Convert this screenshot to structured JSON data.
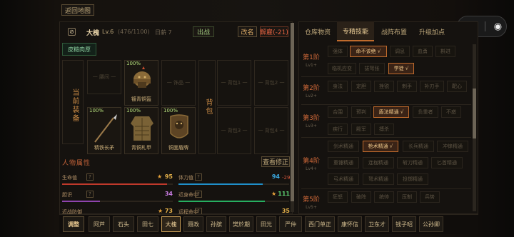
{
  "top": {
    "back_button": "返回地图"
  },
  "mini": {
    "dots_icon": "•••",
    "close_icon": "◉"
  },
  "hero": {
    "name": "大槐",
    "level": "Lv.6",
    "exp": "(476/1100)",
    "salary": "日薪 7",
    "expedition_button": "出战",
    "rename_button": "改名",
    "dismiss_button": "解雇(-21)",
    "tag": "皮糙肉厚"
  },
  "equip": {
    "left_label": "当前装备",
    "right_label": "背包",
    "slot_empty_1": "一 腰间 一",
    "slot_empty_2": "一 饰品 一",
    "helmet_pct": "100%",
    "helmet_name": "镀青铜盔",
    "weapon_pct": "100%",
    "weapon_name": "精铁长矛",
    "armor_pct": "100%",
    "armor_name": "青铜札甲",
    "shield_pct": "100%",
    "shield_name": "铜面盾牌",
    "bag1": "一 背包1 一",
    "bag2": "一 背包2 一",
    "bag3": "一 背包3 一",
    "bag4": "一 背包4 一"
  },
  "attrs": {
    "title": "人物属性",
    "detail_button": "查看修正",
    "hp_label": "生命值",
    "hp_value": "95",
    "hp_fill": 0.95,
    "stamina_label": "体力值",
    "stamina_value": "94",
    "stamina_delta": "-29",
    "stamina_fill": 0.76,
    "courage_label": "胆识",
    "courage_value": "34",
    "courage_fill": 0.34,
    "melee_label": "近身命中",
    "melee_value": "111",
    "melee_fill": 0.78,
    "ranged_label": "远程命中",
    "ranged_value": "35",
    "dodge_label": "近战防御",
    "dodge_value": "73",
    "help_mark": "?",
    "star": "★"
  },
  "tabs": {
    "t1": "仓库物资",
    "t2": "专精技能",
    "t3": "战阵布置",
    "t4": "升级加点"
  },
  "tiers": {
    "r1": "第1阶",
    "r1s": "Lv1+",
    "r2": "第2阶",
    "r2s": "Lv2+",
    "r3": "第3阶",
    "r3s": "Lv3+",
    "r4": "第4阶",
    "r4s": "Lv4+",
    "r5": "第5阶",
    "r5s": "Lv5+"
  },
  "skills": {
    "a1": "强体",
    "a2": "命不该绝 √",
    "a3": "调息",
    "a4": "血勇",
    "a5": "斟进",
    "b1": "临机应变",
    "b2": "拔弩张",
    "b3": "学徒 √",
    "c1": "身法",
    "c2": "定胆",
    "c3": "挫锐",
    "c4": "刺手",
    "c5": "补刃手",
    "c6": "靶心",
    "d1": "合围",
    "d2": "预判",
    "d3": "盾法精通 √",
    "d4": "负重者",
    "d5": "不惑",
    "e1": "疾行",
    "e2": "殿军",
    "e3": "搏杀",
    "f1": "剑术精通",
    "f2": "枪术精通 √",
    "f3": "长兵精通",
    "f4": "冲锋精通",
    "g1": "重锤精通",
    "g2": "连枷精通",
    "g3": "斩刀精通",
    "g4": "匕首精通",
    "h1": "弓术精通",
    "h2": "弩术精通",
    "h3": "投掷精通",
    "i1": "狂怒",
    "i2": "破阵",
    "i3": "统帅",
    "i4": "压制",
    "i5": "兵势"
  },
  "roster": {
    "label": "调整",
    "names": [
      "阿芦",
      "石头",
      "田七",
      "大槐",
      "聂政",
      "孙膑",
      "樊於期",
      "田光",
      "严仲",
      "西门单正",
      "康怀信",
      "卫东才",
      "钱子昭",
      "公孙卿"
    ],
    "selected": "大槐"
  },
  "colors": {
    "accent": "#c06b2c",
    "hp": "#c0392b",
    "stamina": "#1f8fc9",
    "courage": "#8e44ad",
    "melee": "#27ae60"
  }
}
